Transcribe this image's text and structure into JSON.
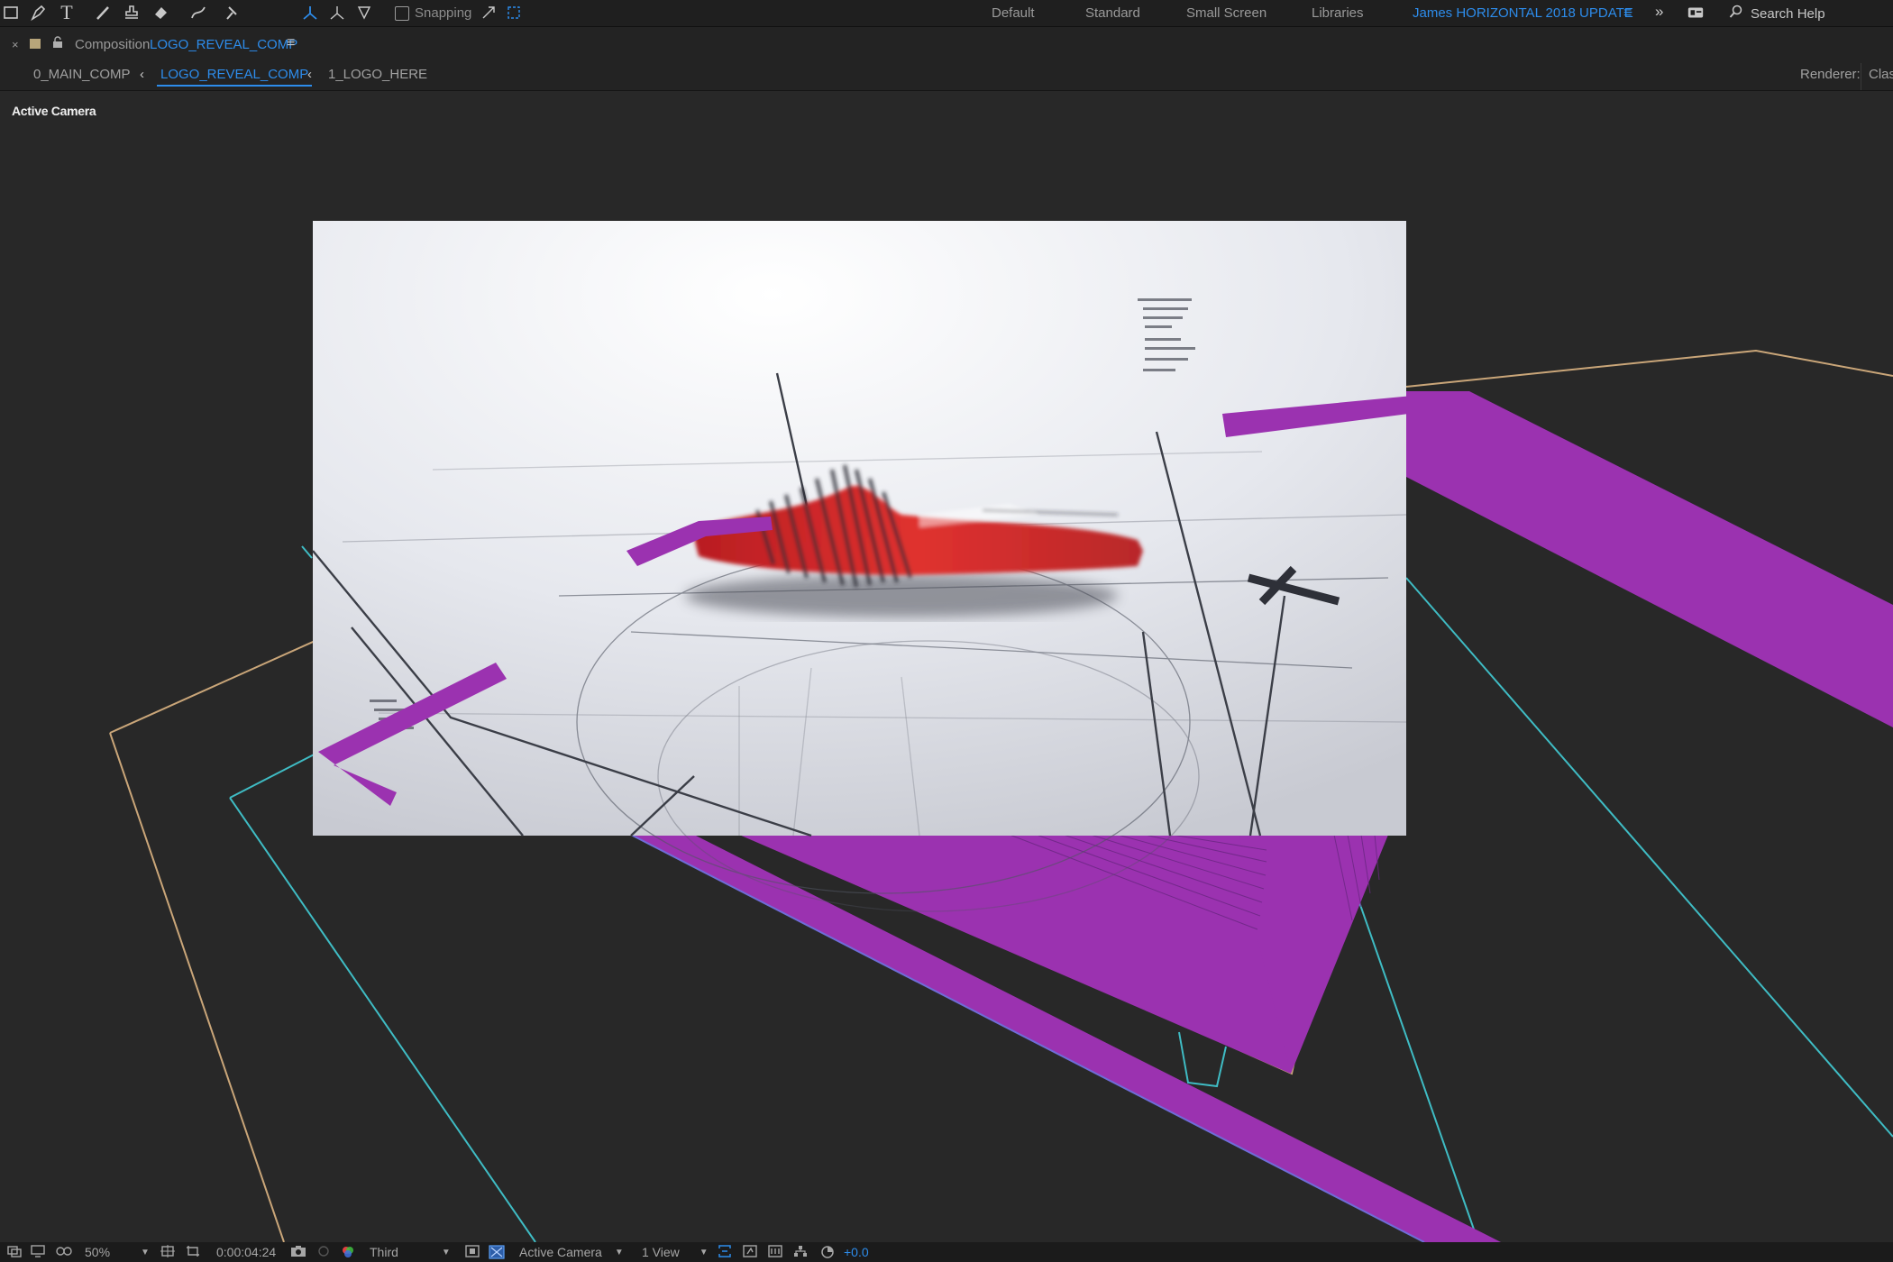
{
  "toolbar": {
    "tools": [
      "rectangle-tool",
      "pen-tool",
      "type-tool",
      "brush-tool",
      "clone-stamp-tool",
      "eraser-tool",
      "roto-brush-tool",
      "puppet-pin-tool",
      "local-axis-mode",
      "world-axis-mode",
      "view-axis-mode"
    ],
    "snapping_label": "Snapping",
    "snapping_checked": false
  },
  "workspaces": {
    "items": [
      "Default",
      "Standard",
      "Small Screen",
      "Libraries"
    ],
    "active": "James HORIZONTAL 2018 UPDATE",
    "overflow_icon": "double-chevron-right-icon"
  },
  "search": {
    "label": "Search Help"
  },
  "composition": {
    "panel_prefix": "Composition",
    "name": "LOGO_REVEAL_COMP",
    "menu_icon": "hamburger-icon"
  },
  "breadcrumbs": {
    "items": [
      "0_MAIN_COMP",
      "LOGO_REVEAL_COMP",
      "1_LOGO_HERE"
    ],
    "active_index": 1
  },
  "renderer": {
    "label": "Renderer:",
    "value": "Clas"
  },
  "viewport": {
    "camera_label": "Active Camera",
    "accent_colors": {
      "layer_fill": "#9b32b0",
      "layer_outline_cyan": "#3fbcc4",
      "layer_outline_tan": "#caa679",
      "logo_red": "#e0312f"
    }
  },
  "statusbar": {
    "zoom": "50%",
    "timecode": "0:00:04:24",
    "resolution": "Third",
    "view": "Active Camera",
    "layout": "1 View",
    "exposure": "+0.0"
  }
}
